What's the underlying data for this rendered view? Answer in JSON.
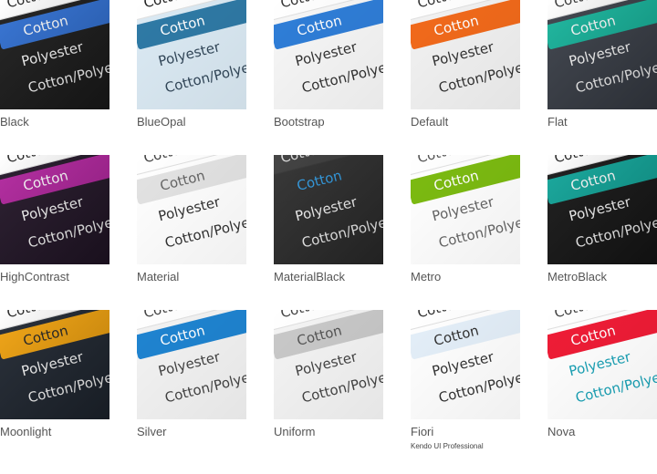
{
  "themes": [
    {
      "name": "Black",
      "sub": "",
      "words": [
        "Cotton",
        "Cotton",
        "Polyester",
        "Cotton/Polyester"
      ],
      "bg": "#1b1b1b",
      "inputBg": "#ffffff",
      "inputColor": "#222222",
      "selBg": "#2f6fd3",
      "selColor": "#ffffff",
      "textColor": "#ffffff",
      "topBar": "#2f6fd3",
      "dark": true
    },
    {
      "name": "BlueOpal",
      "sub": "",
      "words": [
        "Cotton",
        "Cotton",
        "Polyester",
        "Cotton/Polyester"
      ],
      "bg": "#dbeaf4",
      "inputBg": "#ffffff",
      "inputColor": "#222222",
      "selBg": "#2f7aa6",
      "selColor": "#ffffff",
      "textColor": "#33485a",
      "topBar": "#4a8ec2",
      "dark": false
    },
    {
      "name": "Bootstrap",
      "sub": "",
      "words": [
        "Cotton",
        "Cotton",
        "Polyester",
        "Cotton/Polyester"
      ],
      "bg": "#f7f7f7",
      "inputBg": "#ffffff",
      "inputColor": "#333333",
      "selBg": "#2f7ed8",
      "selColor": "#ffffff",
      "textColor": "#333333",
      "topBar": "#2f7ed8",
      "dark": false
    },
    {
      "name": "Default",
      "sub": "",
      "words": [
        "Cotton",
        "Cotton",
        "Polyester",
        "Cotton/Polyester"
      ],
      "bg": "#f2f2f2",
      "inputBg": "#ffffff",
      "inputColor": "#333333",
      "selBg": "#f26a1b",
      "selColor": "#ffffff",
      "textColor": "#333333",
      "topBar": "#f26a1b",
      "dark": false
    },
    {
      "name": "Flat",
      "sub": "",
      "words": [
        "Cotton",
        "Cotton",
        "Polyester",
        "Cotton/Polyester"
      ],
      "bg": "#3a3f48",
      "inputBg": "#ffffff",
      "inputColor": "#333333",
      "selBg": "#15b59c",
      "selColor": "#ffffff",
      "textColor": "#ffffff",
      "topBar": "#15b59c",
      "dark": true
    },
    {
      "name": "HighContrast",
      "sub": "",
      "words": [
        "Cotton",
        "Cotton",
        "Polyester",
        "Cotton/Polyester"
      ],
      "bg": "#221527",
      "inputBg": "#ffffff",
      "inputColor": "#222222",
      "selBg": "#b2249e",
      "selColor": "#ffffff",
      "textColor": "#ffffff",
      "topBar": "#b2249e",
      "dark": true
    },
    {
      "name": "Material",
      "sub": "",
      "words": [
        "Cotton",
        "Cotton",
        "Polyester",
        "Cotton/Polyester"
      ],
      "bg": "#ffffff",
      "inputBg": "#ffffff",
      "inputColor": "#444444",
      "selBg": "#e3e3e3",
      "selColor": "#666666",
      "textColor": "#333333",
      "topBar": "#dddddd",
      "dark": false
    },
    {
      "name": "MaterialBlack",
      "sub": "",
      "words": [
        "Cotton",
        "Cotton",
        "Polyester",
        "Cotton/Polyester"
      ],
      "bg": "#2d2d2d",
      "inputBg": "#3a3a3a",
      "inputColor": "#dddddd",
      "selBg": "#2d2d2d",
      "selColor": "#2f9ee8",
      "textColor": "#ffffff",
      "topBar": "#4a4a4a",
      "dark": true
    },
    {
      "name": "Metro",
      "sub": "",
      "words": [
        "Cotton",
        "Cotton",
        "Polyester",
        "Cotton/Polyester"
      ],
      "bg": "#ffffff",
      "inputBg": "#ffffff",
      "inputColor": "#555555",
      "selBg": "#7cbb11",
      "selColor": "#ffffff",
      "textColor": "#666666",
      "topBar": "#7cbb11",
      "dark": false
    },
    {
      "name": "MetroBlack",
      "sub": "",
      "words": [
        "Cotton",
        "Cotton",
        "Polyester",
        "Cotton/Polyester"
      ],
      "bg": "#161616",
      "inputBg": "#ffffff",
      "inputColor": "#222222",
      "selBg": "#0fa69a",
      "selColor": "#ffffff",
      "textColor": "#ffffff",
      "topBar": "#0fa69a",
      "dark": true
    },
    {
      "name": "Moonlight",
      "sub": "",
      "words": [
        "Cotton",
        "Cotton",
        "Polyester",
        "Cotton/Polyester"
      ],
      "bg": "#1f2630",
      "inputBg": "#ffffff",
      "inputColor": "#222222",
      "selBg": "#f2a20c",
      "selColor": "#222222",
      "textColor": "#ffffff",
      "topBar": "#f2a20c",
      "dark": true
    },
    {
      "name": "Silver",
      "sub": "",
      "words": [
        "Cotton",
        "Cotton",
        "Polyester",
        "Cotton/Polyester"
      ],
      "bg": "#f3f3f3",
      "inputBg": "#ffffff",
      "inputColor": "#444444",
      "selBg": "#1f84d1",
      "selColor": "#ffffff",
      "textColor": "#444444",
      "topBar": "#1f84d1",
      "dark": false
    },
    {
      "name": "Uniform",
      "sub": "",
      "words": [
        "Cotton",
        "Cotton",
        "Polyester",
        "Cotton/Polyester"
      ],
      "bg": "#f4f4f4",
      "inputBg": "#ffffff",
      "inputColor": "#444444",
      "selBg": "#c9c9c9",
      "selColor": "#555555",
      "textColor": "#444444",
      "topBar": "#c8c8c8",
      "dark": false
    },
    {
      "name": "Fiori",
      "sub": "Kendo UI Professional",
      "words": [
        "Cotton",
        "Cotton",
        "Polyester",
        "Cotton/Polyester"
      ],
      "bg": "#ffffff",
      "inputBg": "#ffffff",
      "inputColor": "#333333",
      "selBg": "#e4eff9",
      "selColor": "#333333",
      "textColor": "#333333",
      "topBar": "#2a6ebf",
      "dark": false
    },
    {
      "name": "Nova",
      "sub": "",
      "words": [
        "Cotton",
        "Cotton",
        "Polyester",
        "Cotton/Polyester"
      ],
      "bg": "#ffffff",
      "inputBg": "#ffffff",
      "inputColor": "#444444",
      "selBg": "#ef1c36",
      "selColor": "#ffffff",
      "textColor": "#1aa1b5",
      "topBar": "#ef1c36",
      "dark": false
    }
  ]
}
